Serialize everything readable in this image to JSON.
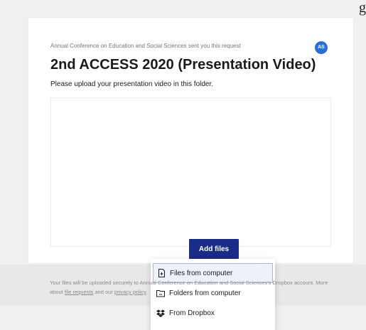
{
  "header": {
    "corner_text": "g"
  },
  "request": {
    "sender_text": "Annual Conference on Education and Social Sciences sent you this request",
    "avatar_initials": "AS",
    "title": "2nd ACCESS 2020 (Presentation Video)",
    "subtitle": "Please upload your presentation video in this folder."
  },
  "upload": {
    "add_files_label": "Add files",
    "menu": [
      {
        "icon": "file-icon",
        "label": "Files from computer"
      },
      {
        "icon": "folder-icon",
        "label": "Folders from computer"
      },
      {
        "icon": "dropbox-icon",
        "label": "From Dropbox"
      }
    ]
  },
  "footer": {
    "text_1": "Your files will be uploaded securely to Annual Conference on Education and Social Sciences's Dropbox account. More about ",
    "link_requests": "file requests",
    "text_2": " and our ",
    "link_privacy": "privacy policy",
    "text_3": "."
  },
  "colors": {
    "primary_button": "#1a2c88",
    "avatar": "#2b6fd6"
  }
}
